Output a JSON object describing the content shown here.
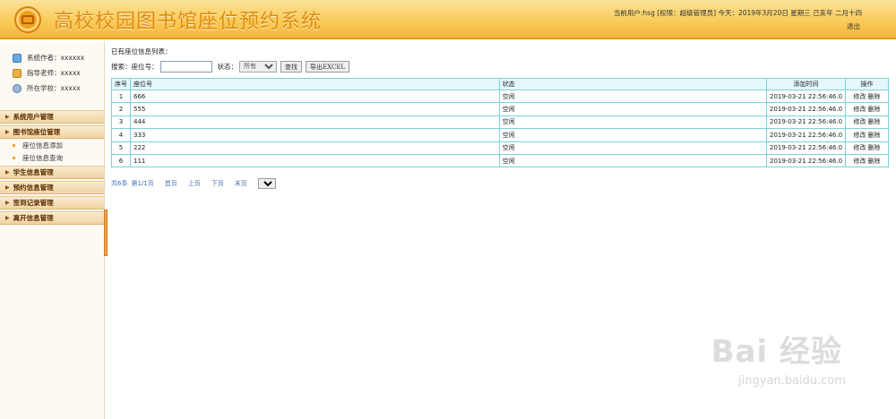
{
  "header": {
    "title": "高校校园图书馆座位预约系统",
    "user_info": "当前用户:hsg [权限：超级管理员]  今天：2019年3月20日 星期三 己亥年 二月十四",
    "logout": "退出"
  },
  "sidebar": {
    "info": [
      {
        "label": "系统作者：xxxxxx",
        "icon": "author-icon"
      },
      {
        "label": "指导老师：xxxxx",
        "icon": "teacher-icon"
      },
      {
        "label": "所在学校：xxxxx",
        "icon": "school-icon"
      }
    ],
    "menus": [
      {
        "label": "系统用户管理"
      },
      {
        "label": "图书馆座位管理",
        "items": [
          "座位信息添加",
          "座位信息查询"
        ]
      },
      {
        "label": "学生信息管理"
      },
      {
        "label": "预约信息管理"
      },
      {
        "label": "签到记录管理"
      },
      {
        "label": "离开信息管理"
      }
    ]
  },
  "main": {
    "list_title": "已有座位信息列表：",
    "search": {
      "label": "搜索：座位号：",
      "seat_value": "",
      "status_label": "状态：",
      "status_selected": "所有",
      "search_btn": "查找",
      "export_btn": "导出EXCEL"
    },
    "table": {
      "headers": [
        "序号",
        "座位号",
        "状态",
        "添加时间",
        "操作"
      ],
      "rows": [
        {
          "no": "1",
          "seat": "666",
          "status": "空闲",
          "time": "2019-03-21 22:56:46.0",
          "edit": "修改",
          "del": "删除"
        },
        {
          "no": "2",
          "seat": "555",
          "status": "空闲",
          "time": "2019-03-21 22:56:46.0",
          "edit": "修改",
          "del": "删除"
        },
        {
          "no": "3",
          "seat": "444",
          "status": "空闲",
          "time": "2019-03-21 22:56:46.0",
          "edit": "修改",
          "del": "删除"
        },
        {
          "no": "4",
          "seat": "333",
          "status": "空闲",
          "time": "2019-03-21 22:56:46.0",
          "edit": "修改",
          "del": "删除"
        },
        {
          "no": "5",
          "seat": "222",
          "status": "空闲",
          "time": "2019-03-21 22:56:46.0",
          "edit": "修改",
          "del": "删除"
        },
        {
          "no": "6",
          "seat": "111",
          "status": "空闲",
          "time": "2019-03-21 22:56:46.0",
          "edit": "修改",
          "del": "删除"
        }
      ]
    },
    "pager": {
      "count": "共6条",
      "page": "第1/1页",
      "first": "首页",
      "prev": "上页",
      "next": "下页",
      "last": "末页",
      "page_select": "1"
    }
  },
  "watermark": {
    "text": "Bai 经验",
    "url": "jingyan.baidu.com"
  },
  "colors": {
    "header_orange": "#f5b73b",
    "title_orange": "#e08a10",
    "table_border": "#7ad3d8",
    "link_blue": "#4670b8"
  }
}
